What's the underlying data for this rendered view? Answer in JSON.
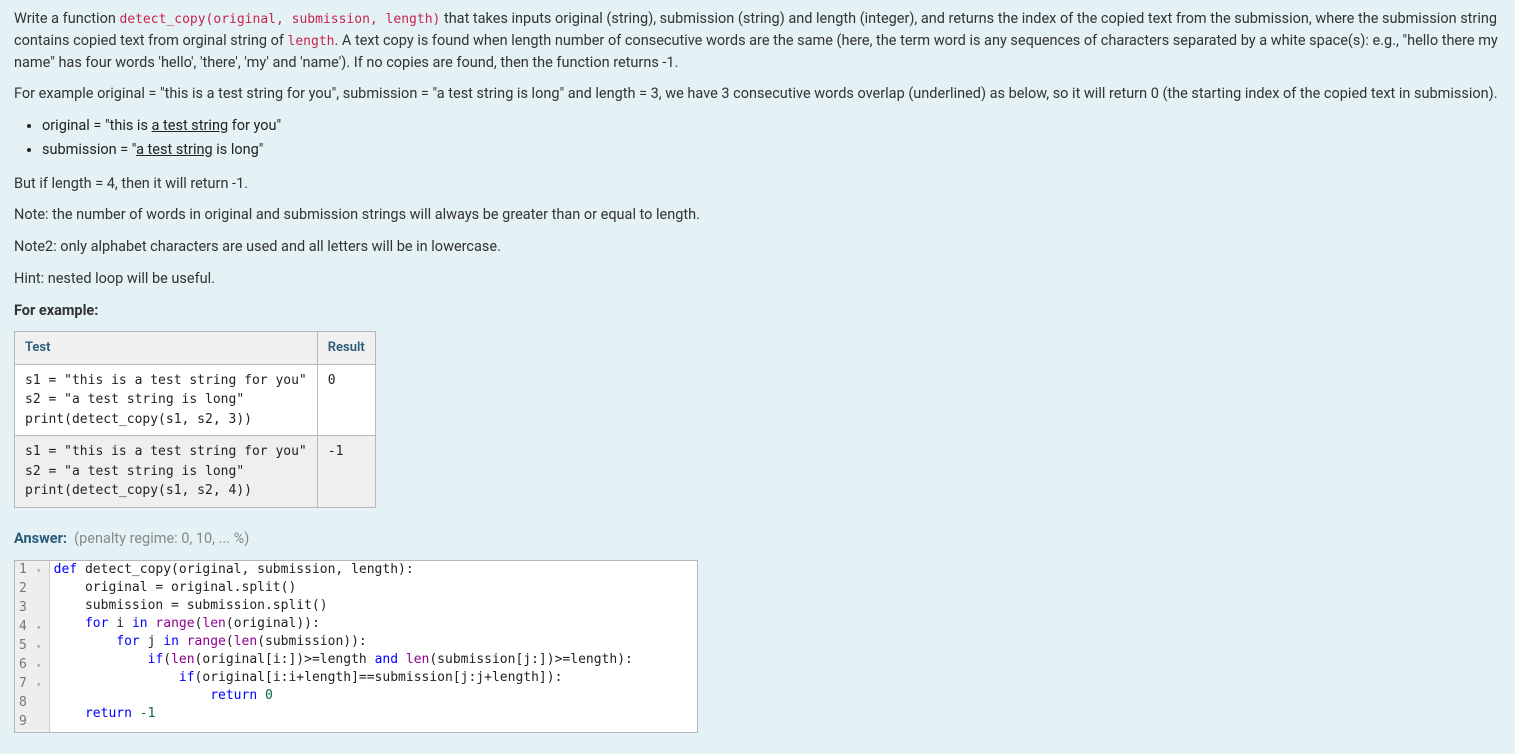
{
  "intro": {
    "pre": "Write a function ",
    "sig": "detect_copy(original, submission, length)",
    "post1": " that takes inputs original (string), submission (string) and length (integer), and returns the index of the copied text from the submission, where the submission string contains copied text from orginal string of ",
    "len": "length",
    "post2": ". A text copy is found when length number of consecutive words are the same (here, the term word is any sequences of characters separated by a white space(s): e.g., \"hello there  my name\" has four words 'hello', 'there', 'my' and 'name'). If no copies are found, then the function returns -1."
  },
  "example_para": "For example original = \"this is a test string for you\", submission = \"a test string is long\" and length = 3, we have 3 consecutive words overlap (underlined) as below, so it will return 0 (the starting index of the copied text in submission).",
  "bullets": {
    "orig_pre": "original = \"this is ",
    "orig_u": "a test string",
    "orig_post": " for you\"",
    "sub_pre": "submission = \"",
    "sub_u": "a test string",
    "sub_post": " is long\""
  },
  "p_len4": "But if length = 4, then it will return -1.",
  "note1": "Note: the number of words in original and submission strings will always be greater than or equal to length.",
  "note2": "Note2: only alphabet characters are used and all letters will be in lowercase.",
  "hint": "Hint: nested loop will be useful.",
  "for_example": "For example:",
  "table": {
    "h_test": "Test",
    "h_result": "Result",
    "rows": [
      {
        "test": "s1 = \"this is a test string for you\"\ns2 = \"a test string is long\"\nprint(detect_copy(s1, s2, 3))",
        "result": "0"
      },
      {
        "test": "s1 = \"this is a test string for you\"\ns2 = \"a test string is long\"\nprint(detect_copy(s1, s2, 4))",
        "result": "-1"
      }
    ]
  },
  "answer_label": "Answer:",
  "penalty": "(penalty regime: 0, 10, ... %)",
  "code": {
    "lines": [
      "1",
      "2",
      "3",
      "4",
      "5",
      "6",
      "7",
      "8",
      "9"
    ],
    "folds": [
      "▾",
      " ",
      " ",
      "▾",
      "▾",
      "▾",
      "▾",
      " ",
      " "
    ],
    "l1_def": "def",
    "l1_name": " detect_copy(original, submission, length):",
    "l2": "    original = original.split()",
    "l3": "    submission = submission.split()",
    "l4_for": "for",
    "l4_i": " i ",
    "l4_in": "in",
    "l4_rest": " range(len(original)):",
    "l5_for": "for",
    "l5_j": " j ",
    "l5_in": "in",
    "l5_rest": " range(len(submission)):",
    "l6_if": "if",
    "l6_a": "(len(original[i:])>=length ",
    "l6_and": "and",
    "l6_b": " len(submission[j:])>=length):",
    "l7_if": "if",
    "l7_a": "(original[i:i+length]==submission[j:j+length]):",
    "l8_ret": "return",
    "l8_v": " 0",
    "l9_ret": "return",
    "l9_v": " -1"
  }
}
